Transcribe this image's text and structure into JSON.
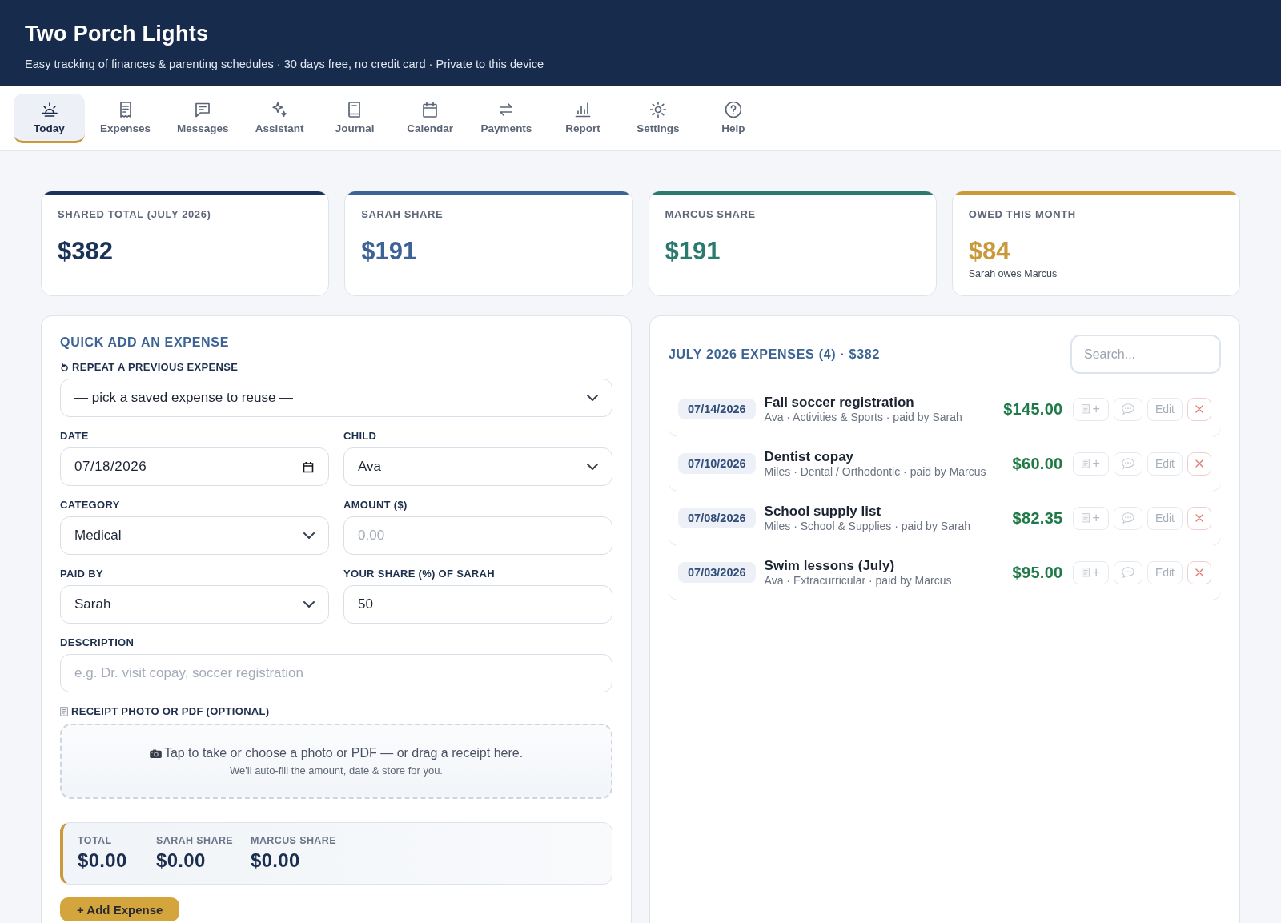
{
  "header": {
    "title": "Two Porch Lights",
    "tagline": "Easy tracking of finances & parenting schedules · 30 days free, no credit card · Private to this device"
  },
  "nav": [
    {
      "label": "Today",
      "selected": true
    },
    {
      "label": "Expenses",
      "selected": false
    },
    {
      "label": "Messages",
      "selected": false
    },
    {
      "label": "Assistant",
      "selected": false
    },
    {
      "label": "Journal",
      "selected": false
    },
    {
      "label": "Calendar",
      "selected": false
    },
    {
      "label": "Payments",
      "selected": false
    },
    {
      "label": "Report",
      "selected": false
    },
    {
      "label": "Settings",
      "selected": false
    },
    {
      "label": "Help",
      "selected": false
    }
  ],
  "stats": [
    {
      "label": "SHARED TOTAL (JULY 2026)",
      "value": "$382",
      "color": "#1b3358"
    },
    {
      "label": "SARAH SHARE",
      "value": "$191",
      "color": "#3d6396"
    },
    {
      "label": "MARCUS SHARE",
      "value": "$191",
      "color": "#2a7a70"
    },
    {
      "label": "OWED THIS MONTH",
      "value": "$84",
      "note": "Sarah owes Marcus",
      "color": "#c9993a"
    }
  ],
  "quick_add": {
    "title": "QUICK ADD AN EXPENSE",
    "repeat_field": {
      "label": "REPEAT A PREVIOUS EXPENSE",
      "value": "— pick a saved expense to reuse —"
    },
    "fields": [
      {
        "label": "DATE",
        "kind": "date",
        "value": "07/18/2026"
      },
      {
        "label": "CHILD",
        "kind": "select",
        "value": "Ava"
      },
      {
        "label": "CATEGORY",
        "kind": "select",
        "value": "Medical"
      },
      {
        "label": "AMOUNT ($)",
        "kind": "text",
        "placeholder": "0.00"
      },
      {
        "label": "PAID BY",
        "kind": "select",
        "value": "Sarah"
      },
      {
        "label": "YOUR SHARE (%) OF SARAH",
        "kind": "text",
        "value": "50"
      }
    ],
    "description_field": {
      "label": "DESCRIPTION",
      "placeholder": "e.g. Dr. visit copay, soccer registration"
    },
    "receipt": {
      "label": "RECEIPT PHOTO OR PDF (OPTIONAL)",
      "prompt": "Tap to take or choose a photo or PDF — or drag a receipt here.",
      "hint": "We'll auto-fill the amount, date & store for you."
    },
    "summary": [
      {
        "label": "TOTAL",
        "value": "$0.00"
      },
      {
        "label": "SARAH SHARE",
        "value": "$0.00"
      },
      {
        "label": "MARCUS SHARE",
        "value": "$0.00"
      }
    ],
    "add_button": "+ Add Expense"
  },
  "expenses": {
    "title": "JULY 2026 EXPENSES (4) · $382",
    "search_placeholder": "Search...",
    "rows": [
      {
        "date": "07/14/2026",
        "title": "Fall soccer registration",
        "details": "Ava · Activities & Sports · paid by Sarah",
        "amount": "$145.00",
        "actions": [
          {
            "kind": "receipt",
            "label": "+"
          },
          {
            "kind": "comment"
          },
          {
            "kind": "edit",
            "label": "Edit"
          },
          {
            "kind": "delete"
          }
        ]
      },
      {
        "date": "07/10/2026",
        "title": "Dentist copay",
        "details": "Miles · Dental / Orthodontic · paid by Marcus",
        "amount": "$60.00",
        "actions": [
          {
            "kind": "receipt",
            "label": "+"
          },
          {
            "kind": "comment"
          },
          {
            "kind": "edit",
            "label": "Edit"
          },
          {
            "kind": "delete"
          }
        ]
      },
      {
        "date": "07/08/2026",
        "title": "School supply list",
        "details": "Miles · School & Supplies · paid by Sarah",
        "amount": "$82.35",
        "actions": [
          {
            "kind": "receipt",
            "label": "+"
          },
          {
            "kind": "comment"
          },
          {
            "kind": "edit",
            "label": "Edit"
          },
          {
            "kind": "delete"
          }
        ]
      },
      {
        "date": "07/03/2026",
        "title": "Swim lessons (July)",
        "details": "Ava · Extracurricular · paid by Marcus",
        "amount": "$95.00",
        "actions": [
          {
            "kind": "receipt",
            "label": "+"
          },
          {
            "kind": "comment"
          },
          {
            "kind": "edit",
            "label": "Edit"
          },
          {
            "kind": "delete"
          }
        ]
      }
    ]
  }
}
